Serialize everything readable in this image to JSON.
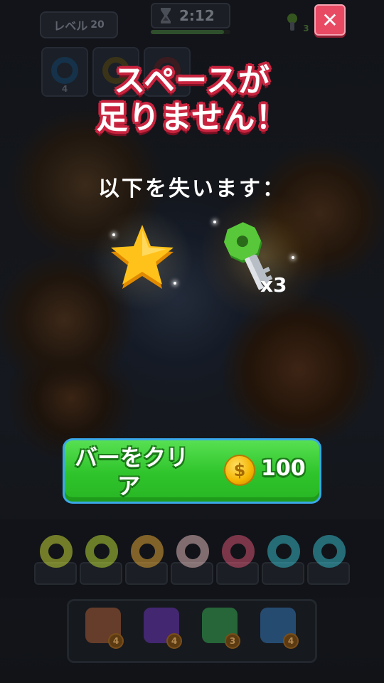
{
  "hud": {
    "level_label": "レベル",
    "level_number": "20",
    "timer": "2:12",
    "timer_progress": 0.92,
    "keys_count": "3",
    "slot_counts": [
      "4",
      "",
      ""
    ]
  },
  "dialog": {
    "title_line1": "スペースが",
    "title_line2": "足りません！",
    "subtitle": "以下を失います：",
    "rewards": [
      {
        "icon": "star-icon"
      },
      {
        "icon": "key-icon",
        "count": "x3"
      }
    ],
    "clear_button": {
      "label_line1": "バーをクリ",
      "label_line2": "ア",
      "coin_symbol": "$",
      "price": "100"
    },
    "close_symbol": "✕"
  },
  "bar_slots": [
    {
      "color": "#d6e83a"
    },
    {
      "color": "#c6e83a"
    },
    {
      "color": "#f2b23a"
    },
    {
      "color": "#f2c7c7"
    },
    {
      "color": "#e85a7a"
    },
    {
      "color": "#3ac6d6"
    },
    {
      "color": "#3ac6d6"
    }
  ],
  "tools": [
    {
      "icon": "vacuum-icon",
      "count": "4"
    },
    {
      "icon": "magnet-icon",
      "count": "4"
    },
    {
      "icon": "fan-icon",
      "count": "3"
    },
    {
      "icon": "blaster-icon",
      "count": "4"
    }
  ],
  "colors": {
    "title_outline": "#c8243f",
    "button_green": "#2fc42b",
    "button_border": "#3aa8e8",
    "close_red": "#e84a63",
    "coin_gold": "#f4b400"
  }
}
